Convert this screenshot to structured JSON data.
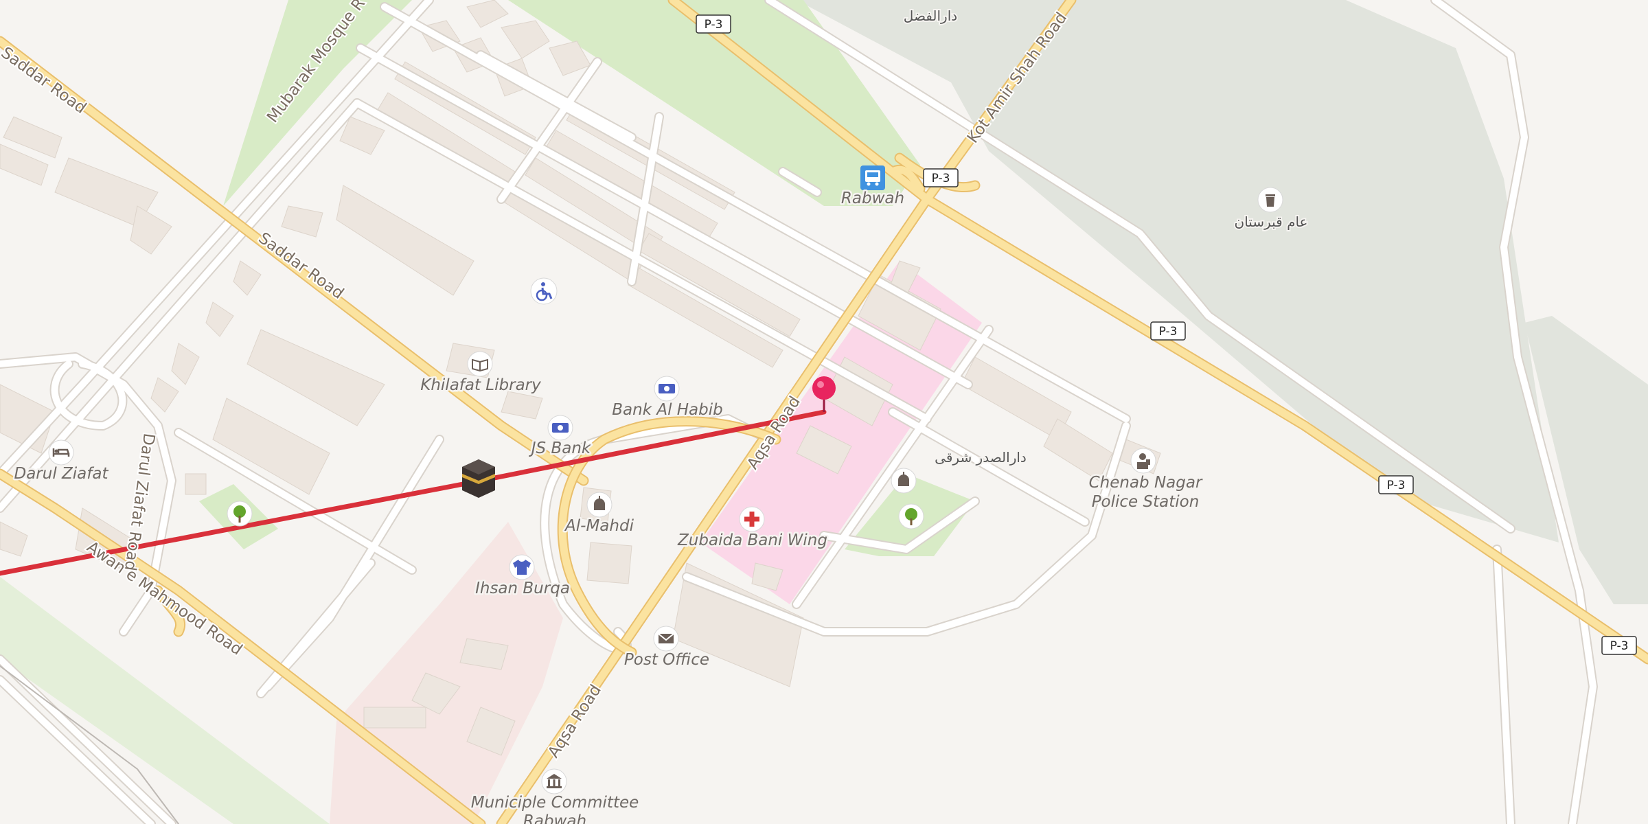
{
  "roads": {
    "saddar_road_top": "Saddar Road",
    "saddar_road_mid": "Saddar Road",
    "mubarak_mosque_road": "Mubarak Mosque R",
    "aqsa_road_upper": "Aqsa Road",
    "aqsa_road_lower": "Aqsa Road",
    "kot_amir_shah_road": "Kot Amir Shah Road",
    "darul_ziafat_road": "Darul Ziafat Road",
    "awan_e_mahmood_road": "Awan e Mahmood Road",
    "route_shield": "P-3"
  },
  "pois": {
    "rabwah": "Rabwah",
    "khilafat_library": "Khilafat Library",
    "bank_al_habib": "Bank Al Habib",
    "js_bank": "JS Bank",
    "darul_ziafat": "Darul Ziafat",
    "al_mahdi": "Al-Mahdi",
    "zubaida_bani_wing": "Zubaida Bani Wing",
    "ihsan_burqa": "Ihsan Burqa",
    "post_office": "Post Office",
    "municipal_committee_1": "Municiple Committee",
    "municipal_committee_2": "Rabwah",
    "police_station_1": "Chenab Nagar",
    "police_station_2": "Police Station",
    "graveyard_urdu": "عام قبرستان",
    "urdu_top": "دارالفضل",
    "urdu_mid": "دارالصدر شرقی"
  },
  "icons": {
    "bus_stop": "bus-icon",
    "library": "book-icon",
    "bank": "banknote-icon",
    "hotel": "bed-icon",
    "mosque": "mosque-icon",
    "hospital": "red-cross-icon",
    "clothes": "shirt-icon",
    "post": "envelope-icon",
    "townhall": "government-icon",
    "police": "police-icon",
    "cemetery": "urn-icon",
    "park": "tree-icon",
    "disabled": "wheelchair-icon",
    "kaaba": "kaaba-icon",
    "pin": "location-pin-icon"
  },
  "colors": {
    "background": "#f6f4f1",
    "major_road": "#fbe3a0",
    "major_road_casing": "#e9bf6c",
    "minor_road": "#ffffff",
    "park": "#d8ebc6",
    "cemetery": "#e1e4dd",
    "hospital_area": "#fbd7e8",
    "building": "#ede6df",
    "route_line": "#d9303a",
    "pin": "#e8245f"
  }
}
